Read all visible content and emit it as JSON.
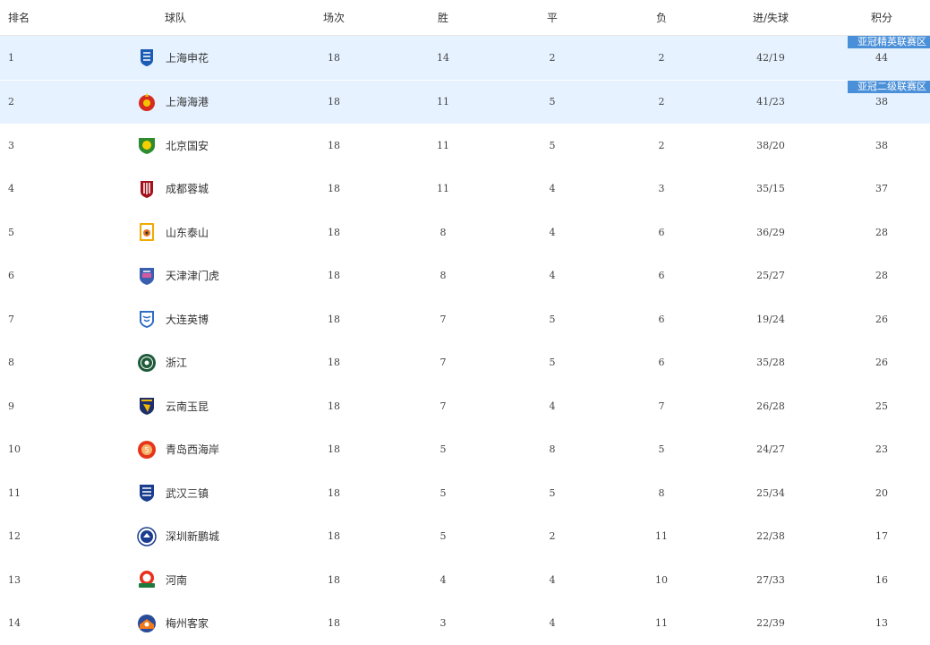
{
  "header": {
    "rank": "排名",
    "team": "球队",
    "played": "场次",
    "win": "胜",
    "draw": "平",
    "loss": "负",
    "goals": "进/失球",
    "points": "积分"
  },
  "tags": {
    "afc_elite": "亚冠精英联赛区",
    "afc_two": "亚冠二级联赛区"
  },
  "rows": [
    {
      "rank": "1",
      "team": "上海申花",
      "played": "18",
      "win": "14",
      "draw": "2",
      "loss": "2",
      "goals": "42/19",
      "points": "44",
      "logo": "shenhua-logo"
    },
    {
      "rank": "2",
      "team": "上海海港",
      "played": "18",
      "win": "11",
      "draw": "5",
      "loss": "2",
      "goals": "41/23",
      "points": "38",
      "logo": "haigang-logo"
    },
    {
      "rank": "3",
      "team": "北京国安",
      "played": "18",
      "win": "11",
      "draw": "5",
      "loss": "2",
      "goals": "38/20",
      "points": "38",
      "logo": "guoan-logo"
    },
    {
      "rank": "4",
      "team": "成都蓉城",
      "played": "18",
      "win": "11",
      "draw": "4",
      "loss": "3",
      "goals": "35/15",
      "points": "37",
      "logo": "rongcheng-logo"
    },
    {
      "rank": "5",
      "team": "山东泰山",
      "played": "18",
      "win": "8",
      "draw": "4",
      "loss": "6",
      "goals": "36/29",
      "points": "28",
      "logo": "taishan-logo"
    },
    {
      "rank": "6",
      "team": "天津津门虎",
      "played": "18",
      "win": "8",
      "draw": "4",
      "loss": "6",
      "goals": "25/27",
      "points": "28",
      "logo": "jinmenhu-logo"
    },
    {
      "rank": "7",
      "team": "大连英博",
      "played": "18",
      "win": "7",
      "draw": "5",
      "loss": "6",
      "goals": "19/24",
      "points": "26",
      "logo": "yingbo-logo"
    },
    {
      "rank": "8",
      "team": "浙江",
      "played": "18",
      "win": "7",
      "draw": "5",
      "loss": "6",
      "goals": "35/28",
      "points": "26",
      "logo": "zhejiang-logo"
    },
    {
      "rank": "9",
      "team": "云南玉昆",
      "played": "18",
      "win": "7",
      "draw": "4",
      "loss": "7",
      "goals": "26/28",
      "points": "25",
      "logo": "yukun-logo"
    },
    {
      "rank": "10",
      "team": "青岛西海岸",
      "played": "18",
      "win": "5",
      "draw": "8",
      "loss": "5",
      "goals": "24/27",
      "points": "23",
      "logo": "xihaian-logo"
    },
    {
      "rank": "11",
      "team": "武汉三镇",
      "played": "18",
      "win": "5",
      "draw": "5",
      "loss": "8",
      "goals": "25/34",
      "points": "20",
      "logo": "sanzhen-logo"
    },
    {
      "rank": "12",
      "team": "深圳新鹏城",
      "played": "18",
      "win": "5",
      "draw": "2",
      "loss": "11",
      "goals": "22/38",
      "points": "17",
      "logo": "xinpengcheng-logo"
    },
    {
      "rank": "13",
      "team": "河南",
      "played": "18",
      "win": "4",
      "draw": "4",
      "loss": "10",
      "goals": "27/33",
      "points": "16",
      "logo": "henan-logo"
    },
    {
      "rank": "14",
      "team": "梅州客家",
      "played": "18",
      "win": "3",
      "draw": "4",
      "loss": "11",
      "goals": "22/39",
      "points": "13",
      "logo": "kejia-logo"
    }
  ],
  "colors": {
    "highlight_row": "#e6f2ff",
    "tag_bg": "#4a90d9",
    "tag_text": "#ffffff"
  }
}
